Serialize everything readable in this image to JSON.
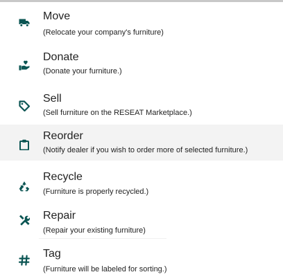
{
  "menu": {
    "items": [
      {
        "key": "move",
        "title": "Move",
        "description": "(Relocate your company's furniture)",
        "icon": "truck-icon"
      },
      {
        "key": "donate",
        "title": "Donate",
        "description": "(Donate your furniture.)",
        "icon": "hand-heart-icon"
      },
      {
        "key": "sell",
        "title": "Sell",
        "description": "(Sell furniture on the RESEAT Marketplace.)",
        "icon": "tag-icon"
      },
      {
        "key": "reorder",
        "title": "Reorder",
        "description": "(Notify dealer if you wish to order more of selected furniture.)",
        "icon": "clipboard-icon"
      },
      {
        "key": "recycle",
        "title": "Recycle",
        "description": "(Furniture is properly recycled.)",
        "icon": "recycle-icon"
      },
      {
        "key": "repair",
        "title": "Repair",
        "description": "(Repair your existing furniture)",
        "icon": "tools-icon"
      },
      {
        "key": "tag",
        "title": "Tag",
        "description": "(Furniture will be labeled for sorting.)",
        "icon": "hashtag-icon"
      }
    ]
  },
  "colors": {
    "accent": "#0b5553",
    "text": "#222222",
    "highlight": "#f3f3f3"
  }
}
